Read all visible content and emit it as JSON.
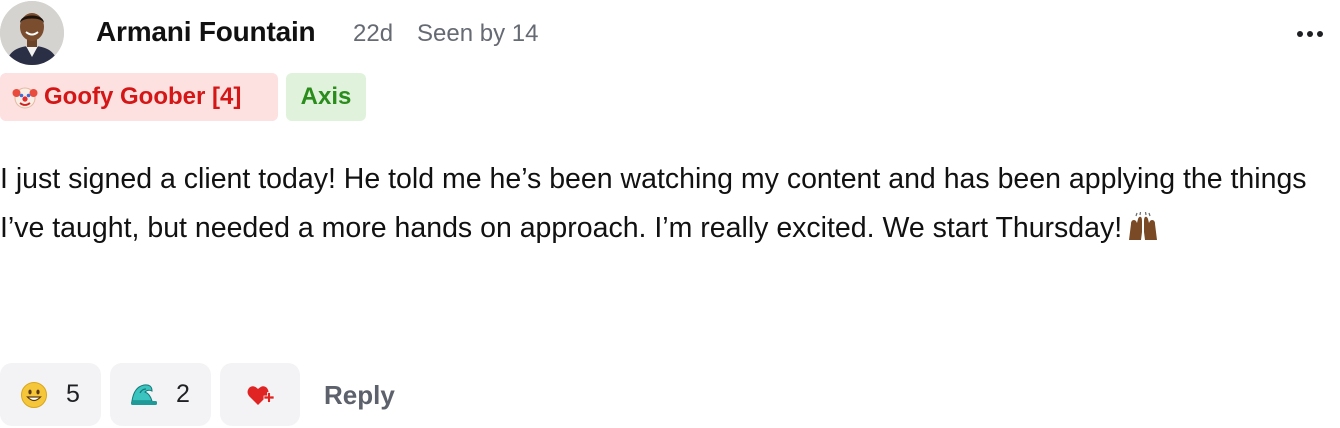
{
  "post": {
    "author_name": "Armani Fountain",
    "age": "22d",
    "seen_by": "Seen by 14",
    "badges": [
      {
        "label": "Goofy Goober [4]",
        "icon": "clown-face-icon"
      },
      {
        "label": "Axis"
      }
    ],
    "body": "I just signed a client today! He told me he’s been watching my content and has been applying the things I’ve taught, but needed a more hands on approach. I’m really excited. We start Thursday!",
    "body_emoji": "raised-hands-icon"
  },
  "reactions": [
    {
      "icon": "grinning-face-icon",
      "count": "5"
    },
    {
      "icon": "wave-icon",
      "count": "2"
    }
  ],
  "actions": {
    "add_reaction_icon": "heart-plus-icon",
    "reply_label": "Reply"
  },
  "colors": {
    "badge_red_bg": "#fde0e0",
    "badge_red_text": "#d41616",
    "badge_green_bg": "#e0f2dc",
    "badge_green_text": "#2a8c1a",
    "reaction_bg": "#f3f3f5",
    "meta_text": "#666a73"
  }
}
